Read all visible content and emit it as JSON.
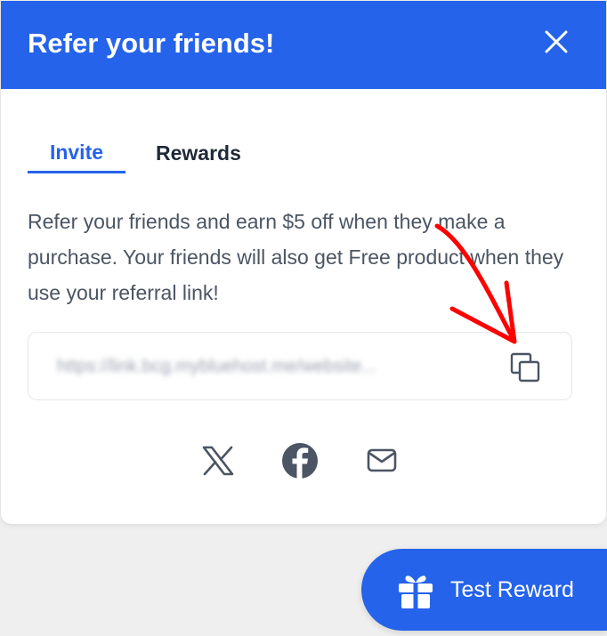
{
  "modal": {
    "title": "Refer your friends!",
    "close_icon": "close-icon"
  },
  "tabs": [
    {
      "label": "Invite",
      "active": true
    },
    {
      "label": "Rewards",
      "active": false
    }
  ],
  "description": "Refer your friends and earn $5 off when they make a purchase. Your friends will also get Free product when they use your referral link!",
  "referral": {
    "link": "https://link.bcg.mybluehost.me/website...",
    "copy_icon": "copy-icon"
  },
  "share": [
    {
      "icon": "x-twitter-icon"
    },
    {
      "icon": "facebook-icon"
    },
    {
      "icon": "mail-icon"
    }
  ],
  "launcher": {
    "label": "Test Reward",
    "icon": "gift-icon"
  },
  "colors": {
    "accent": "#2563eb",
    "annotation": "#ff0000",
    "text": "#4b5563",
    "heading": "#1f2937"
  }
}
